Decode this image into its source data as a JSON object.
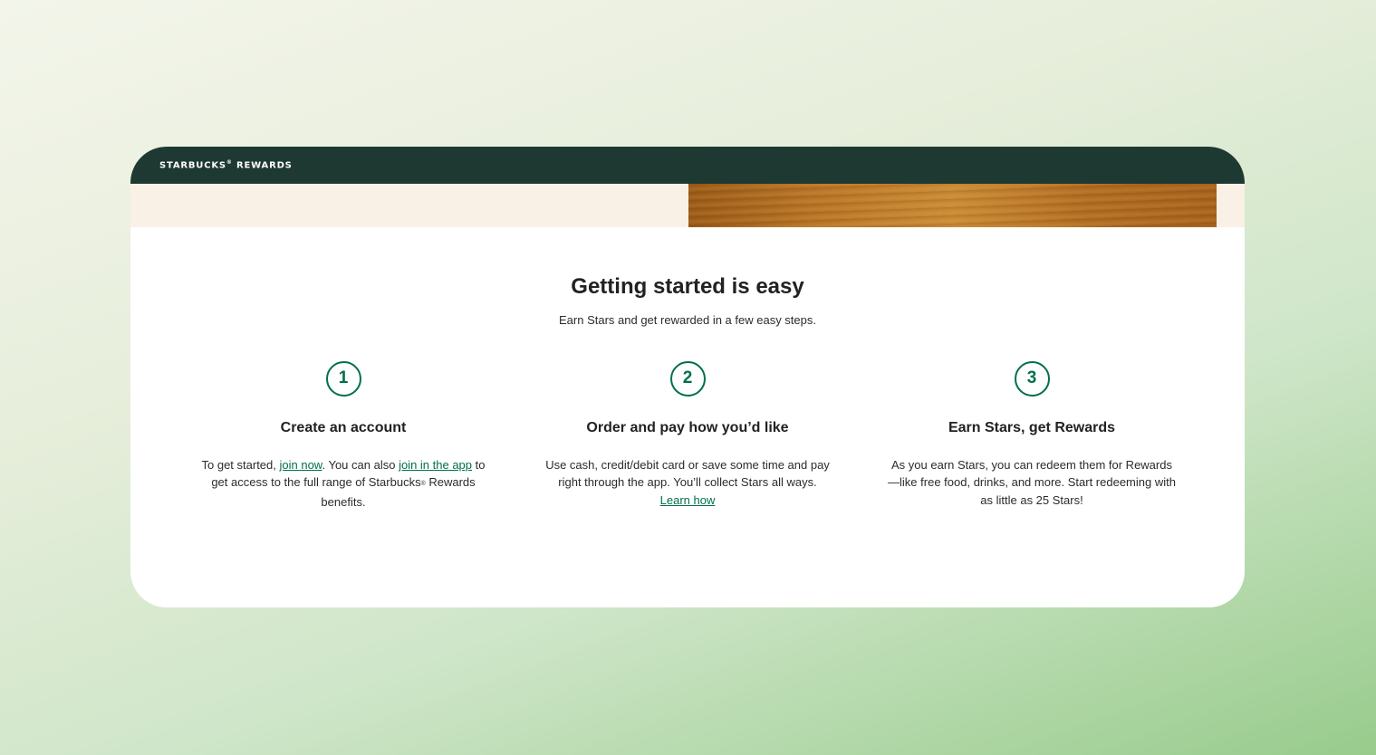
{
  "header": {
    "brand": "STARBUCKS",
    "brand_mark": "®",
    "brand_suffix": "REWARDS"
  },
  "main": {
    "title": "Getting started is easy",
    "subtitle": "Earn Stars and get rewarded in a few easy steps."
  },
  "steps": [
    {
      "number": "1",
      "title": "Create an account",
      "text_before": "To get started, ",
      "link1": "join now",
      "text_middle": ". You can also ",
      "link2": "join in the app",
      "text_after": " to get access to the full range of Starbucks",
      "reg": "®",
      "text_end": " Rewards benefits."
    },
    {
      "number": "2",
      "title": "Order and pay how you’d like",
      "text": "Use cash, credit/debit card or save some time and pay right through the app. You’ll collect Stars all ways. ",
      "link": "Learn how"
    },
    {
      "number": "3",
      "title": "Earn Stars, get Rewards",
      "text": "As you earn Stars, you can redeem them for Rewards—like free food, drinks, and more. Start redeeming with as little as 25 Stars!"
    }
  ],
  "colors": {
    "header_bg": "#1e3932",
    "accent_green": "#00704a",
    "hero_bg": "#f9f1e5"
  }
}
